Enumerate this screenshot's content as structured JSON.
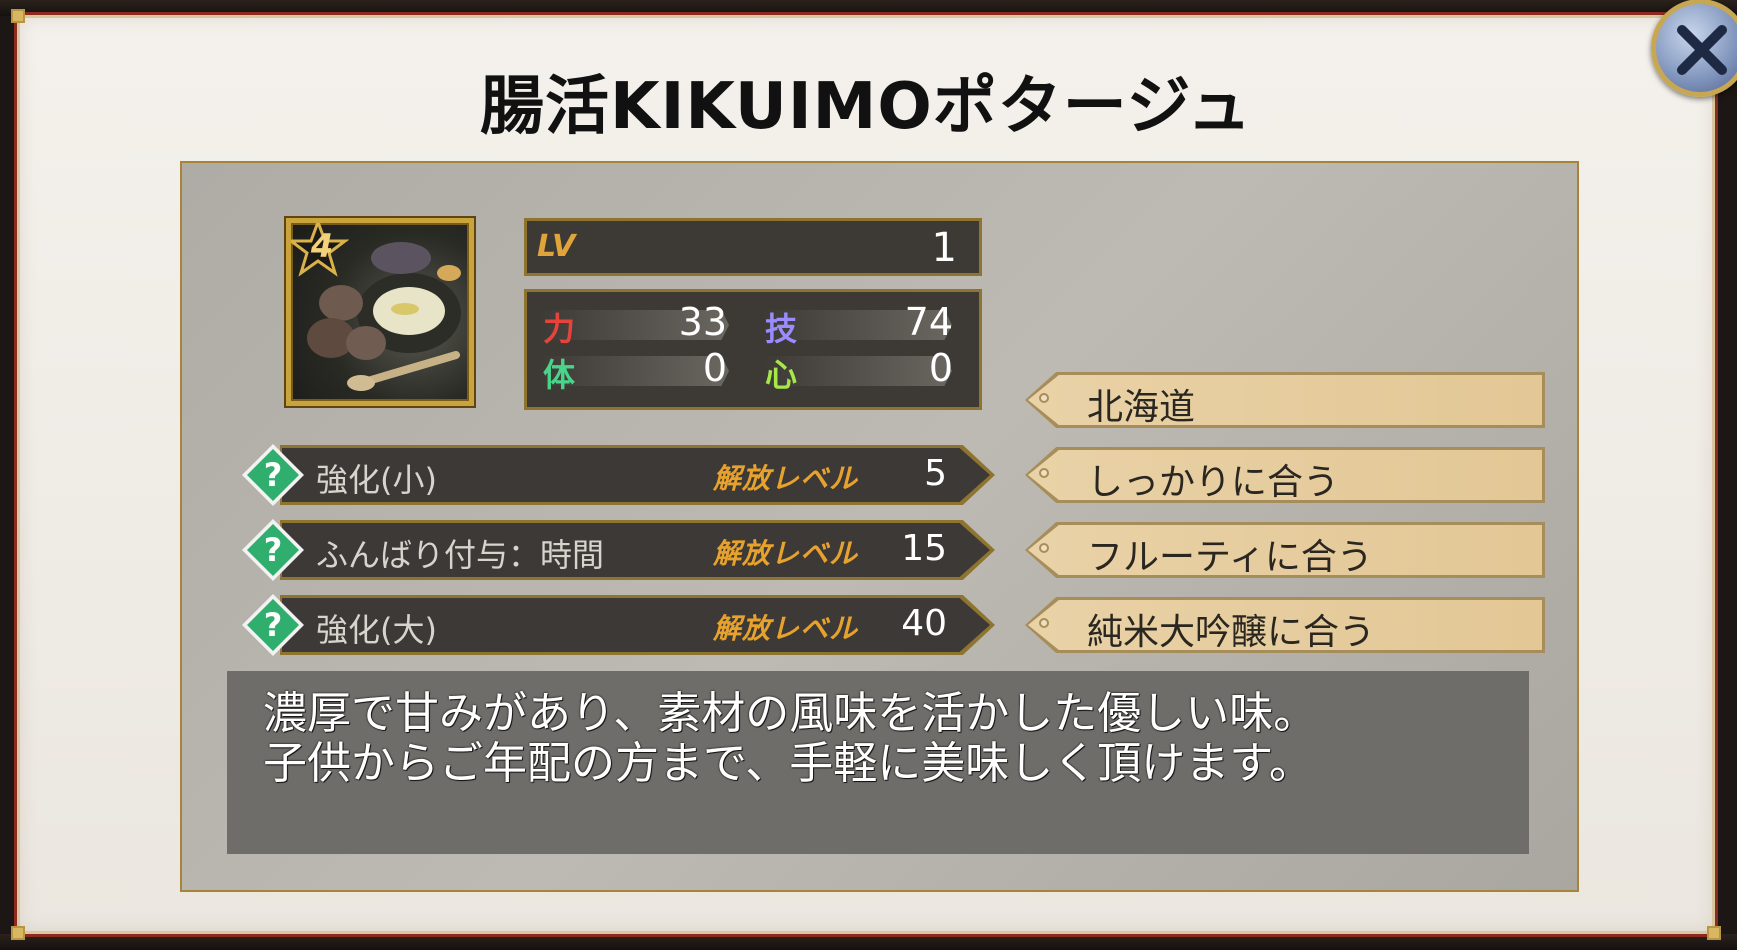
{
  "item": {
    "title": "腸活KIKUIMOポタージュ",
    "rarity": "4",
    "lv_label": "LV",
    "lv_value": "1"
  },
  "stats": [
    {
      "label": "力",
      "value": "33",
      "color": "#e8433a"
    },
    {
      "label": "技",
      "value": "74",
      "color": "#9a8cff"
    },
    {
      "label": "体",
      "value": "0",
      "color": "#49d48a"
    },
    {
      "label": "心",
      "value": "0",
      "color": "#a6e84a"
    }
  ],
  "abilities": [
    {
      "name": "強化(小)",
      "unlock_label": "解放レベル",
      "unlock_level": "5"
    },
    {
      "name": "ふんばり付与：時間",
      "unlock_label": "解放レベル",
      "unlock_level": "15"
    },
    {
      "name": "強化(大)",
      "unlock_label": "解放レベル",
      "unlock_level": "40"
    }
  ],
  "tags": [
    "北海道",
    "しっかりに合う",
    "フルーティに合う",
    "純米大吟醸に合う"
  ],
  "description": [
    "濃厚で甘みがあり、素材の風味を活かした優しい味。",
    "子供からご年配の方まで、手軽に美味しく頂けます。"
  ],
  "icons": {
    "close": "close-icon",
    "unknown": "question-mark-icon",
    "rarity": "star-badge-icon"
  },
  "colors": {
    "accent_gold": "#c9a43c",
    "unlock_orange": "#e7a12d",
    "tag_bg": "#e9d2a7",
    "frame_red": "#8c2a1f"
  }
}
